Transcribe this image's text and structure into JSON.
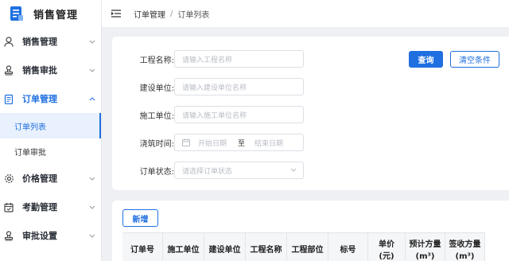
{
  "app": {
    "title": "销售管理"
  },
  "sidebar": {
    "items": [
      {
        "label": "销售管理",
        "icon": "user-icon",
        "expanded": false
      },
      {
        "label": "销售审批",
        "icon": "stamp-icon",
        "expanded": false
      },
      {
        "label": "订单管理",
        "icon": "order-icon",
        "expanded": true,
        "active": true,
        "children": [
          {
            "label": "订单列表",
            "active": true
          },
          {
            "label": "订单审批",
            "active": false
          }
        ]
      },
      {
        "label": "价格管理",
        "icon": "gear-icon",
        "expanded": false
      },
      {
        "label": "考勤管理",
        "icon": "calendar-icon",
        "expanded": false
      },
      {
        "label": "审批设置",
        "icon": "stamp-icon",
        "expanded": false
      }
    ]
  },
  "header": {
    "breadcrumb": [
      "订单管理",
      "订单列表"
    ],
    "separator": "/"
  },
  "filters": {
    "project_name": {
      "label": "工程名称:",
      "placeholder": "请输入工程名称"
    },
    "builder": {
      "label": "建设单位:",
      "placeholder": "请输入建设单位名称"
    },
    "contractor": {
      "label": "施工单位:",
      "placeholder": "请输入施工单位名称"
    },
    "pour_time": {
      "label": "浇筑时间:",
      "start_placeholder": "开始日期",
      "to": "至",
      "end_placeholder": "结束日期"
    },
    "order_status": {
      "label": "订单状态:",
      "placeholder": "请选择订单状态"
    },
    "search_label": "查询",
    "clear_label": "清空条件"
  },
  "table": {
    "add_label": "新增",
    "columns": [
      "订单号",
      "施工单位",
      "建设单位",
      "工程名称",
      "工程部位",
      "标号",
      "单价(元)",
      "预计方量(m³)",
      "签收方量(m³)"
    ]
  },
  "colors": {
    "accent": "#1f6fe0",
    "active_bg": "#e8f1fd",
    "page_bg": "#eef0f4"
  }
}
